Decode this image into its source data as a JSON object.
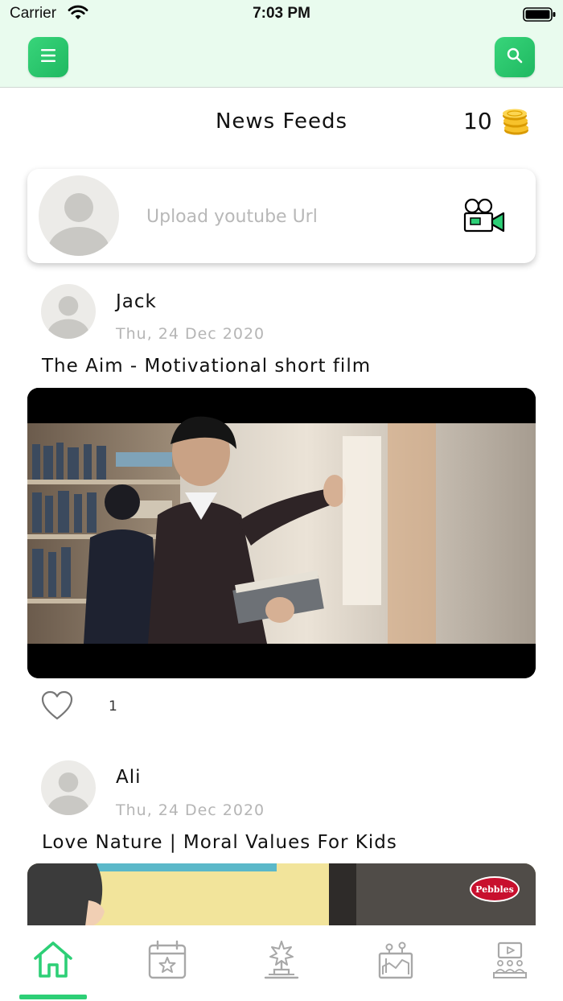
{
  "status_bar": {
    "carrier": "Carrier",
    "time": "7:03 PM"
  },
  "header": {
    "title": "News Feeds",
    "coins": "10"
  },
  "upload": {
    "placeholder": "Upload youtube Url"
  },
  "posts": [
    {
      "author": "Jack",
      "date": "Thu, 24 Dec 2020",
      "title": "The Aim - Motivational short film",
      "likes": "1"
    },
    {
      "author": "Ali",
      "date": "Thu, 24 Dec 2020",
      "title": "Love Nature | Moral Values For Kids",
      "thumbnail_badge": "Pebbles"
    }
  ],
  "bottom_nav": {
    "active": "home",
    "items": [
      "home-icon",
      "calendar-star-icon",
      "award-statue-icon",
      "stage-podium-icon",
      "video-audience-icon"
    ]
  },
  "colors": {
    "accent": "#2dcf76",
    "topbar": "#e9fbee",
    "placeholder": "#b8b8b8",
    "date": "#b5b5b5",
    "badge": "#c8102e"
  }
}
